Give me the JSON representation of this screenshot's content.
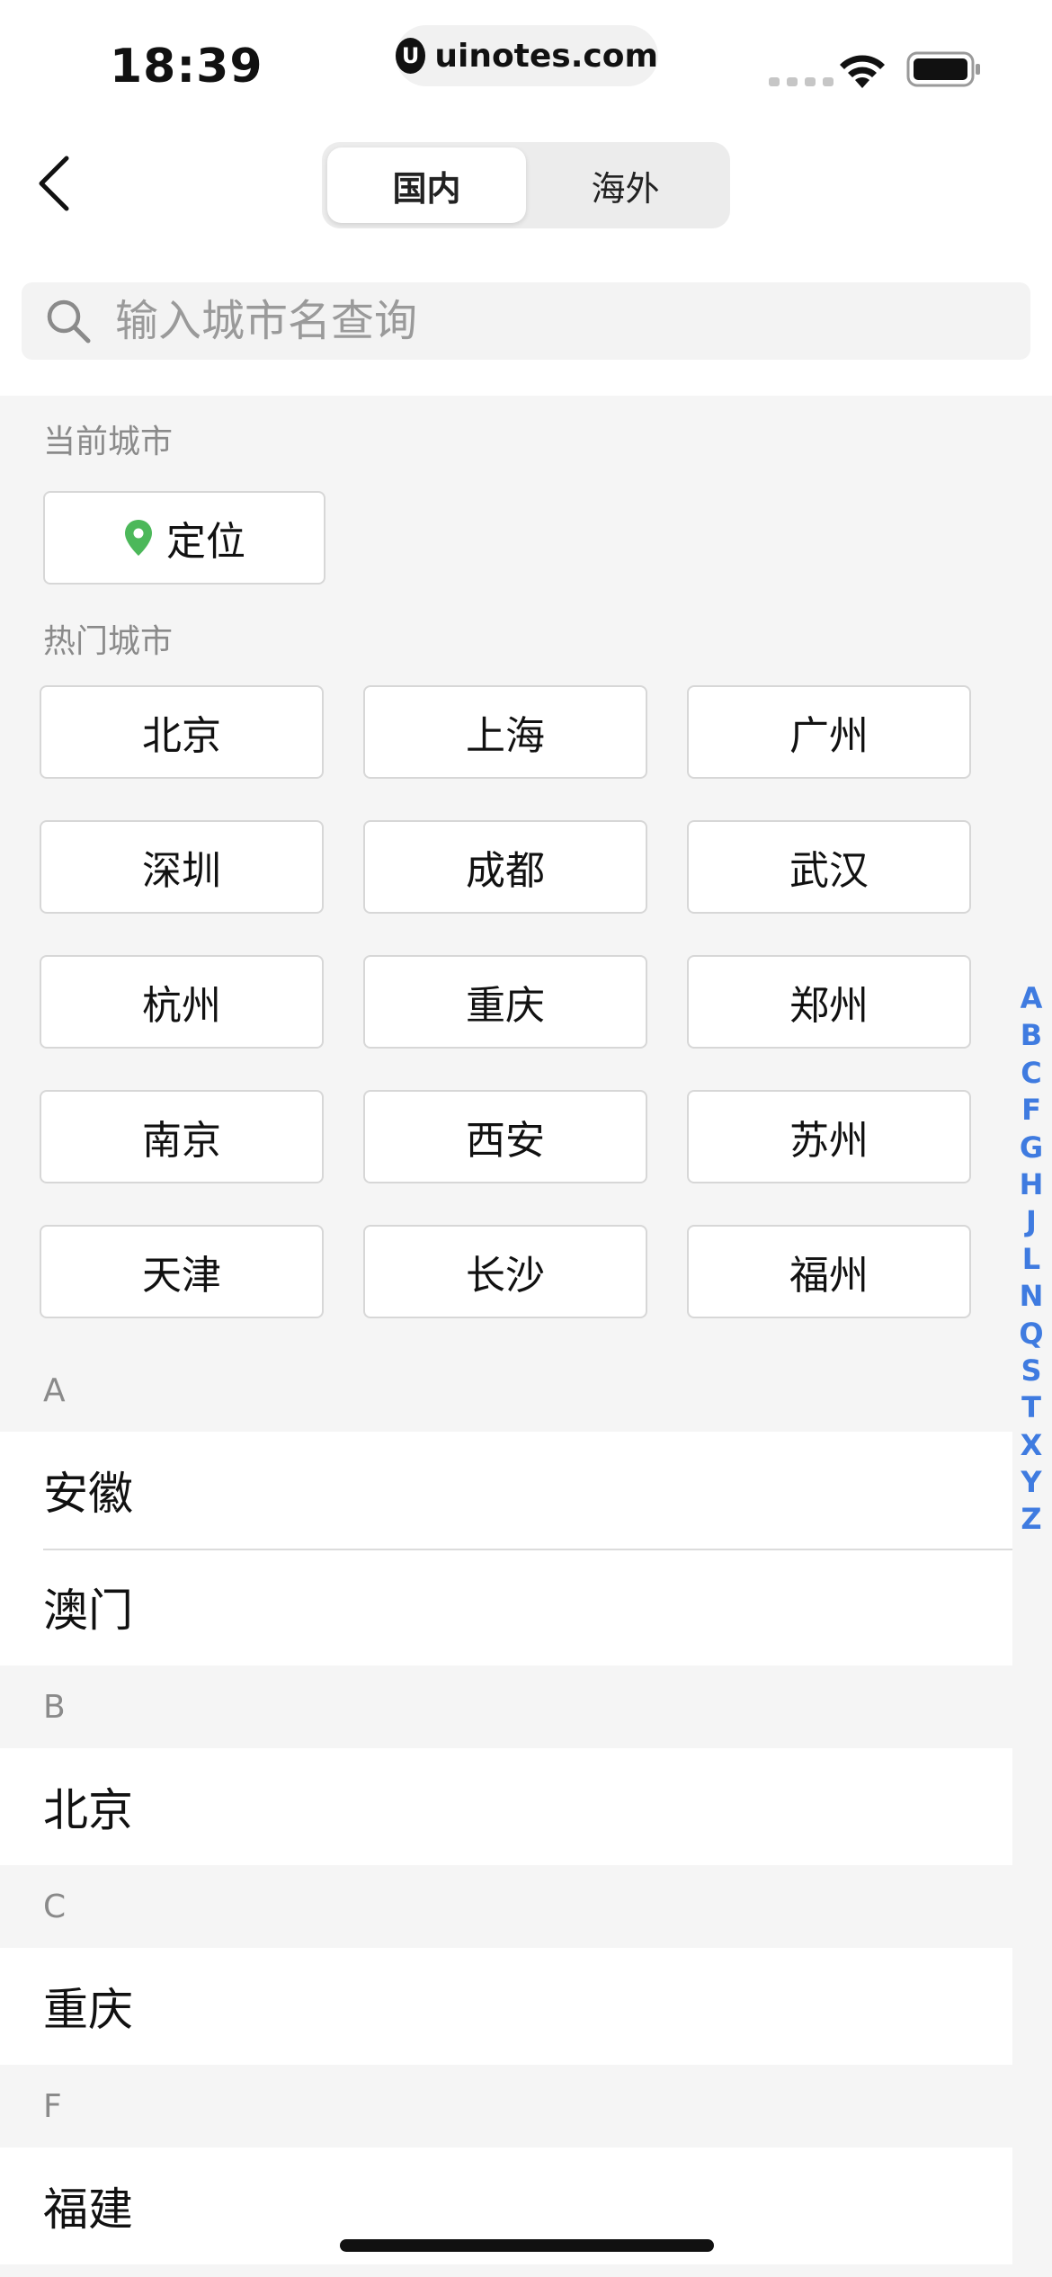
{
  "status_bar": {
    "time": "18:39",
    "url": "uinotes.com",
    "url_logo": "U"
  },
  "nav": {
    "tabs": [
      {
        "label": "国内",
        "active": true
      },
      {
        "label": "海外",
        "active": false
      }
    ]
  },
  "search": {
    "placeholder": "输入城市名查询"
  },
  "current_city": {
    "section_label": "当前城市",
    "locate_label": "定位"
  },
  "hot_cities": {
    "section_label": "热门城市",
    "items": [
      "北京",
      "上海",
      "广州",
      "深圳",
      "成都",
      "武汉",
      "杭州",
      "重庆",
      "郑州",
      "南京",
      "西安",
      "苏州",
      "天津",
      "长沙",
      "福州"
    ]
  },
  "city_list": {
    "groups": [
      {
        "letter": "A",
        "items": [
          "安徽",
          "澳门"
        ]
      },
      {
        "letter": "B",
        "items": [
          "北京"
        ]
      },
      {
        "letter": "C",
        "items": [
          "重庆"
        ]
      },
      {
        "letter": "F",
        "items": [
          "福建"
        ]
      }
    ]
  },
  "index_bar": {
    "letters": [
      "A",
      "B",
      "C",
      "F",
      "G",
      "H",
      "J",
      "L",
      "N",
      "Q",
      "S",
      "T",
      "X",
      "Y",
      "Z"
    ]
  },
  "colors": {
    "accent": "#3f7be0",
    "pin": "#4cb85a",
    "background": "#f5f5f5"
  }
}
